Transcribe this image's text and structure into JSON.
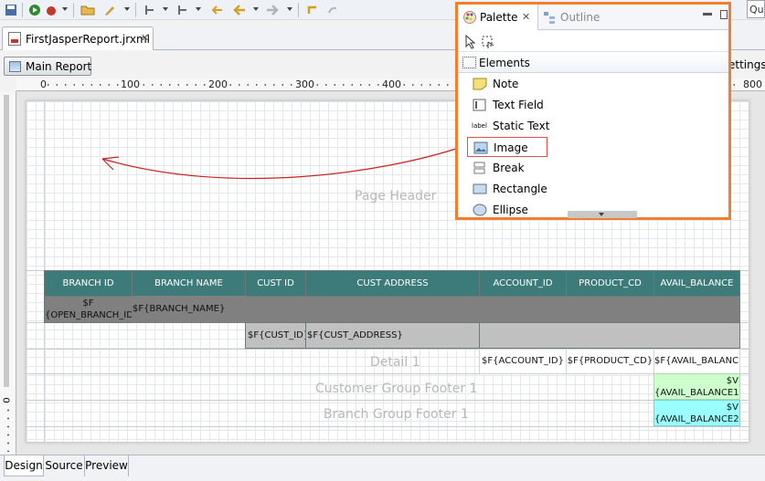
{
  "toolbar": {
    "quick_access": "Qui"
  },
  "editor": {
    "tab_title": "FirstJasperReport.jrxml"
  },
  "report": {
    "main_report_label": "Main Report",
    "settings_label": "ettings"
  },
  "ruler": {
    "labels": [
      "0",
      "100",
      "200",
      "300",
      "400",
      "800"
    ],
    "vertical_label": "0"
  },
  "bands": {
    "page_header": "Page Header",
    "detail": "Detail 1",
    "customer_group_footer": "Customer Group Footer 1",
    "branch_group_footer": "Branch Group Footer 1"
  },
  "table": {
    "headers": [
      "BRANCH ID",
      "BRANCH NAME",
      "CUST ID",
      "CUST ADDRESS",
      "ACCOUNT_ID",
      "PRODUCT_CD",
      "AVAIL_BALANCE"
    ],
    "branch_group": {
      "open_branch_id": "$F\n{OPEN_BRANCH_ID}",
      "branch_name": "$F{BRANCH_NAME}"
    },
    "customer_group": {
      "cust_id": "$F{CUST_ID}",
      "cust_address": "$F{CUST_ADDRESS}"
    },
    "detail": {
      "account_id": "$F{ACCOUNT_ID}",
      "product_cd": "$F{PRODUCT_CD}",
      "avail_balance": "$F{AVAIL_BALANCE}"
    },
    "customer_footer_value": "$V\n{AVAIL_BALANCE1}",
    "branch_footer_value": "$V\n{AVAIL_BALANCE2}"
  },
  "bottom_tabs": [
    "Design",
    "Source",
    "Preview"
  ],
  "palette": {
    "tab_palette": "Palette",
    "tab_outline": "Outline",
    "group_label": "Elements",
    "items": [
      "Note",
      "Text Field",
      "Static Text",
      "Image",
      "Break",
      "Rectangle",
      "Ellipse"
    ],
    "static_text_icon_text": "label",
    "selected_item": "Image"
  },
  "colors": {
    "header_fill": "#3d7b7a",
    "branch_group_fill": "#808080",
    "customer_group_fill": "#c0c0c0",
    "customer_footer_fill": "#ccffcc",
    "branch_footer_fill": "#99ffff",
    "palette_border": "#f08030",
    "drag_arrow": "#cc2222"
  }
}
